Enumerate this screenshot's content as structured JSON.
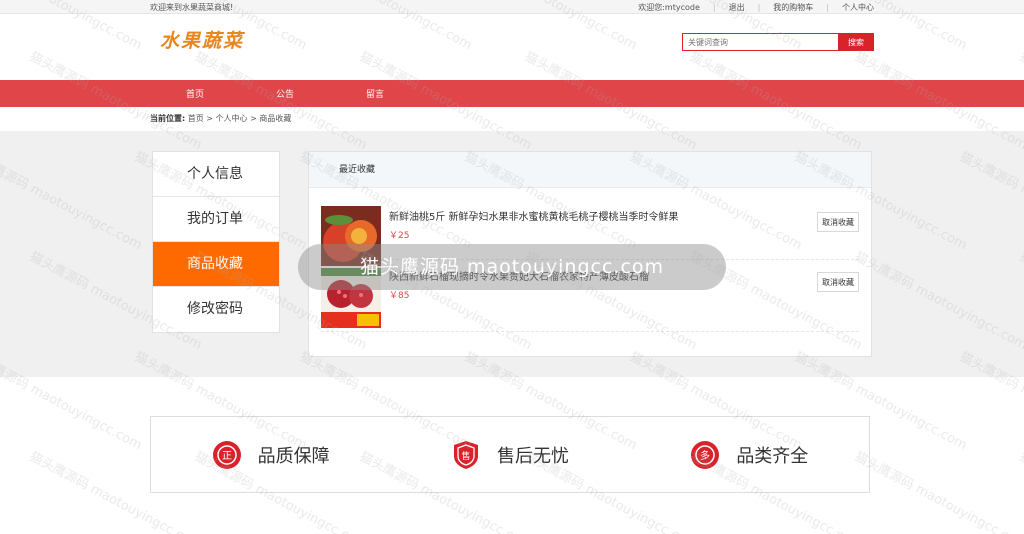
{
  "topbar": {
    "welcome": "欢迎来到水果蔬菜商城!",
    "user_prefix": "欢迎您:",
    "username": "mtycode",
    "logout": "退出",
    "cart": "我的购物车",
    "center": "个人中心"
  },
  "header": {
    "logo": "水果蔬菜",
    "search_placeholder": "关键词查询",
    "search_button": "搜索"
  },
  "nav": [
    "首页",
    "公告",
    "留言"
  ],
  "breadcrumb": {
    "label": "当前位置:",
    "path": "首页 > 个人中心 > 商品收藏"
  },
  "sidebar": {
    "items": [
      {
        "label": "个人信息"
      },
      {
        "label": "我的订单"
      },
      {
        "label": "商品收藏"
      },
      {
        "label": "修改密码"
      }
    ]
  },
  "panel": {
    "title": "最近收藏",
    "items": [
      {
        "title": "新鲜油桃5斤 新鲜孕妇水果非水蜜桃黄桃毛桃子樱桃当季时令鲜果",
        "price": "￥25",
        "button": "取消收藏"
      },
      {
        "title": "陕西新鲜石榴现摘时令水果贵妃大石榴农家特产薄皮酸石榴",
        "price": "￥85",
        "button": "取消收藏"
      }
    ]
  },
  "features": [
    {
      "icon_char": "正",
      "label": "品质保障",
      "icon": "quality-icon"
    },
    {
      "icon_char": "售",
      "label": "售后无忧",
      "icon": "after-sale-icon"
    },
    {
      "icon_char": "多",
      "label": "品类齐全",
      "icon": "variety-icon"
    }
  ],
  "overlay": "猫头鹰源码 maotouyingcc.com",
  "colors": {
    "brand_red": "#e0454a",
    "active_orange": "#ff6a00",
    "logo_orange": "#e8861f"
  }
}
